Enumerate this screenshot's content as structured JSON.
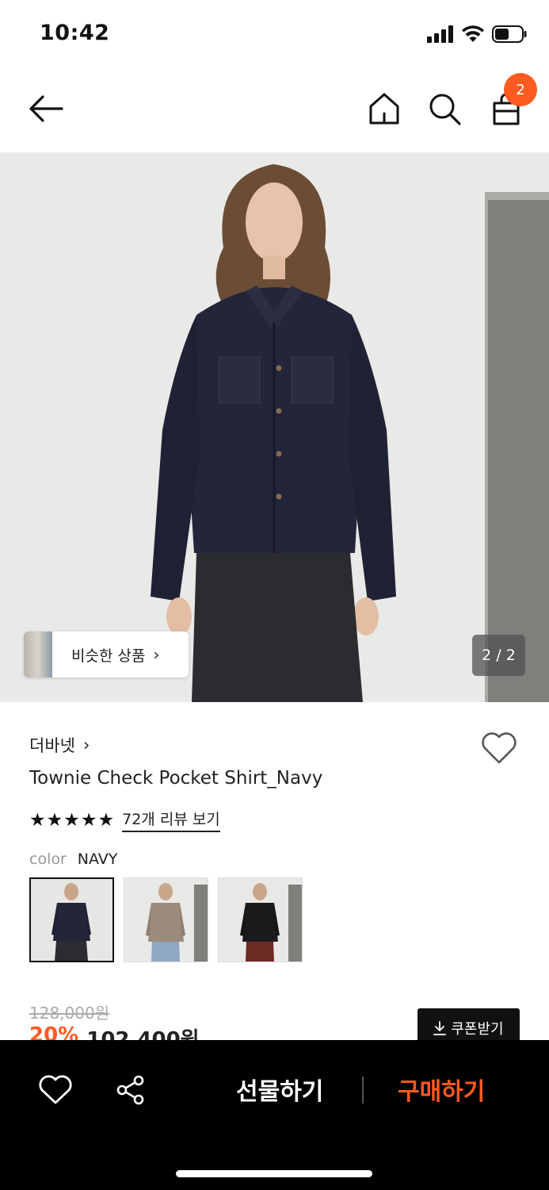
{
  "status_bar": {
    "time": "10:42"
  },
  "nav": {
    "cart_count": "2",
    "icons": [
      "back-arrow-icon",
      "home-icon",
      "search-icon",
      "shopping-bag-icon"
    ]
  },
  "gallery": {
    "similar_label": "비슷한 상품",
    "counter": "2 / 2"
  },
  "product": {
    "brand": "더바넷",
    "name": "Townie Check Pocket Shirt_Navy",
    "rating": 5,
    "review_link": "72개 리뷰 보기",
    "color_label": "color",
    "color_value": "NAVY",
    "swatches": [
      "navy",
      "beige",
      "black"
    ]
  },
  "price": {
    "original": "128,000원",
    "discount_rate": "20%",
    "sale": "102,400원",
    "coupon_label": "쿠폰받기"
  },
  "bottom_bar": {
    "gift_label": "선물하기",
    "buy_label": "구매하기"
  },
  "colors": {
    "accent": "#ff5a1f",
    "bottom_bar_bg": "#000000"
  }
}
